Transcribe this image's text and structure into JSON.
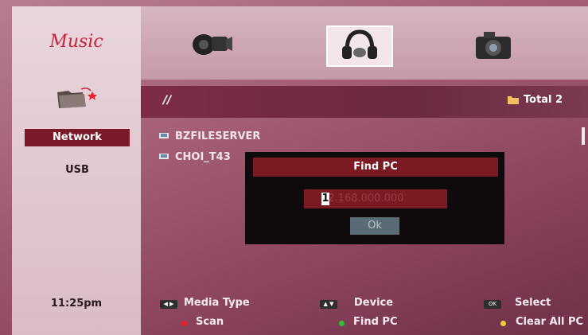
{
  "sidebar": {
    "title": "Music",
    "items": [
      {
        "label": "Network",
        "active": true
      },
      {
        "label": "USB",
        "active": false
      }
    ],
    "clock": "11:25pm"
  },
  "tabs": [
    {
      "name": "video",
      "icon": "film-camera-icon",
      "selected": false
    },
    {
      "name": "music",
      "icon": "headphones-icon",
      "selected": true
    },
    {
      "name": "photo",
      "icon": "photo-camera-icon",
      "selected": false
    }
  ],
  "path": {
    "current": "//",
    "total": "Total 2"
  },
  "files": [
    {
      "name": "BZFILESERVER"
    },
    {
      "name": "CHOI_T43"
    }
  ],
  "dialog": {
    "title": "Find PC",
    "ip_cursor_char": "1",
    "ip_value": "92.168.000.000",
    "ok_label": "Ok"
  },
  "footer": {
    "media_type": "Media Type",
    "device": "Device",
    "select": "Select",
    "scan": "Scan",
    "find_pc": "Find PC",
    "clear_all": "Clear All PC",
    "key_lr": "◀ ▶",
    "key_ud": "▲ ▼",
    "key_ok": "OK"
  },
  "colors": {
    "accent_red": "#7a1a22",
    "music_red": "#c8233a",
    "dot_red": "#e8202a",
    "dot_green": "#2bbf3a",
    "dot_yellow": "#f0d030"
  }
}
